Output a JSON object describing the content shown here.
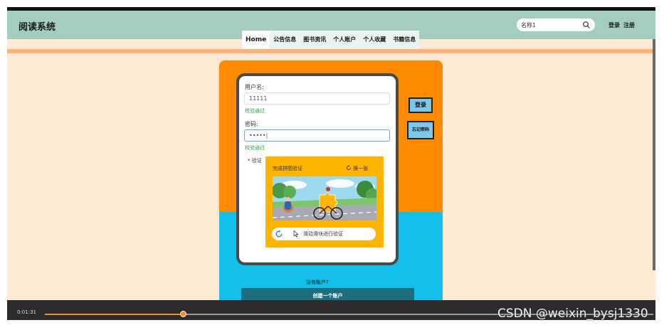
{
  "header": {
    "app_title": "阅读系统",
    "search_value": "名称1",
    "login_link": "登录",
    "register_link": "注册"
  },
  "nav": {
    "items": [
      "Home",
      "公告信息",
      "图书资讯",
      "个人账户",
      "个人收藏",
      "书籍信息"
    ],
    "active": "Home"
  },
  "form": {
    "username_label": "用户名:",
    "username_value": "11111",
    "username_status": "校验通过",
    "password_label": "密码:",
    "password_value": "•••••|",
    "password_status": "校验通过",
    "verify_label": "* 验证",
    "login_button": "登录",
    "forgot_button": "忘记密码"
  },
  "captcha": {
    "title": "完成拼图验证",
    "refresh": "换一张",
    "slider_hint": "滑动滑块进行验证"
  },
  "register": {
    "question": "没有账户?",
    "button": "创建一个账户"
  },
  "player": {
    "time": "0:01:31",
    "progress": 0.227
  },
  "watermark": "CSDN @weixin_bysj1330",
  "colors": {
    "header": "#a3cdbc",
    "page_bg": "#ffe8d4",
    "panel_top": "#ff8a00",
    "panel_bottom": "#12c0ea",
    "button": "#7cc8ea",
    "register_button": "#1d6f7f",
    "captcha_bg": "#ffb400",
    "status_ok": "#2fa24a",
    "progress": "#f58a1f"
  },
  "icons": [
    "search-icon",
    "refresh-icon",
    "slider-refresh-icon",
    "cursor-icon"
  ]
}
